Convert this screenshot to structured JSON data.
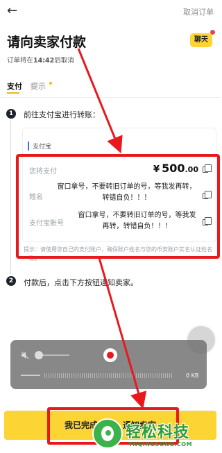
{
  "header": {
    "back_icon": "arrow-left-icon",
    "cancel_label": "取消订单",
    "title": "请向卖家付款",
    "deadline_prefix": "订单将在",
    "deadline_time": "14:42",
    "deadline_suffix": "后取消",
    "chat_label": "聊天"
  },
  "tabs": [
    {
      "label": "支付",
      "active": true
    },
    {
      "label": "提示",
      "active": false,
      "has_dot": true
    }
  ],
  "steps": {
    "step1": {
      "number": "1",
      "text": "前往支付宝进行转账："
    },
    "step2": {
      "number": "2",
      "text": "付款后，点击下方按钮通知卖家。"
    }
  },
  "payment": {
    "method": "支付宝",
    "rows": {
      "amount": {
        "label": "您将支付",
        "symbol": "¥",
        "integer": "500",
        "decimal": ".00"
      },
      "name": {
        "label": "姓名",
        "value": "窗口拿号，不要转旧订单的号，等我发再转，转错自负！！！"
      },
      "account": {
        "label": "支付宝账号",
        "value": "窗口拿号，不要转旧订单的号，等我发再转，转错自负！！！"
      }
    },
    "tip": "提示：请使用您自己的支付账户，确保账户姓名与您的币安账户实名认证姓名一致。"
  },
  "recorder": {
    "file_size": "0 KB"
  },
  "bottom_button": {
    "label": "我已完成付款，通知卖家"
  },
  "watermark": {
    "text": "轻松科技",
    "url": "YNQINGSONG.COM"
  },
  "colors": {
    "accent": "#fcd535",
    "highlight": "#e8191c",
    "watermark_green": "#2d9b3c",
    "link_blue": "#2e74f5"
  }
}
